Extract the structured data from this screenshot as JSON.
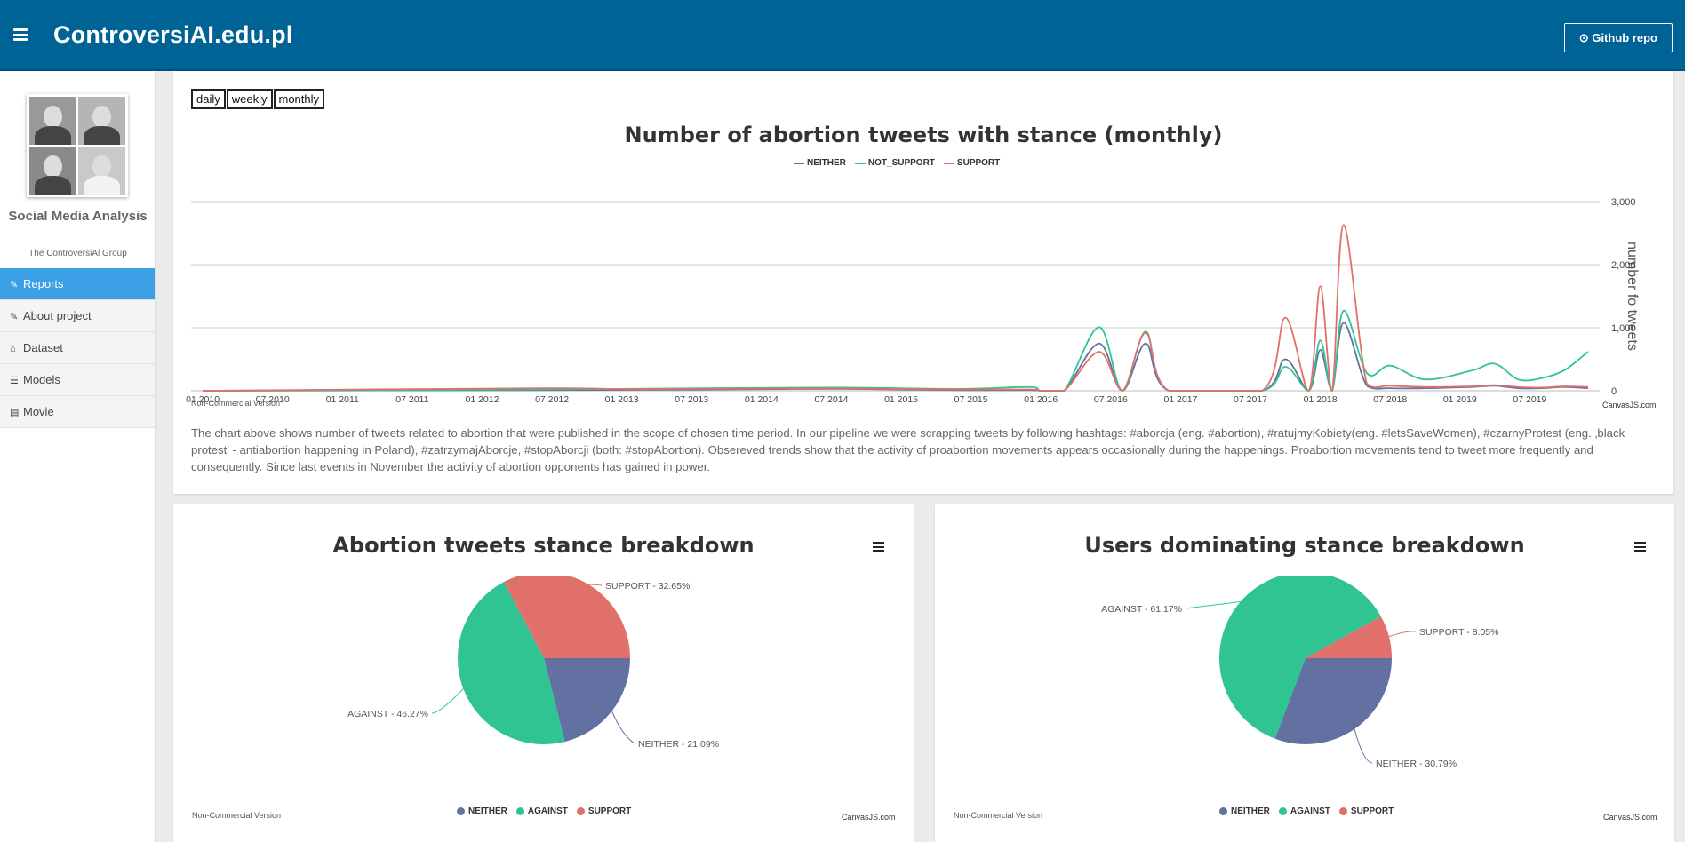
{
  "app": {
    "title": "ControversiAI.edu.pl",
    "github_label": "Github repo"
  },
  "sidebar": {
    "title": "Social Media Analysis",
    "subtitle": "The ControversiAl Group",
    "items": [
      {
        "label": "Reports",
        "icon": "edit-icon",
        "active": true
      },
      {
        "label": "About project",
        "icon": "edit-icon",
        "active": false
      },
      {
        "label": "Dataset",
        "icon": "home-icon",
        "active": false
      },
      {
        "label": "Models",
        "icon": "bars-icon",
        "active": false
      },
      {
        "label": "Movie",
        "icon": "file-icon",
        "active": false
      }
    ]
  },
  "range_buttons": [
    "daily",
    "weekly",
    "monthly"
  ],
  "colors": {
    "neither": "#6270a2",
    "against": "#2fc492",
    "support": "#e2706a",
    "header": "#006395",
    "active": "#3ca0e6"
  },
  "line_chart": {
    "watermark": "Non-Commercial Version",
    "credit": "CanvasJS.com",
    "description": "The chart above shows number of tweets related to abortion that were published in the scope of chosen time period. In our pipeline we were scrapping tweets by following hashtags: #aborcja (eng. #abortion), #ratujmyKobiety(eng. #letsSaveWomen), #czarnyProtest (eng. ‚black protest' - antiabortion happening in Poland), #zatrzymajAborcje, #stopAborcji (both: #stopAbortion). Obsereved trends show that the activity of proabortion movements appears occasionally during the happenings. Proabortion movements tend to tweet more frequently and consequently. Since last events in November the activity of abortion opponents has gained in power."
  },
  "pie_left": {
    "watermark": "Non-Commercial Version",
    "credit": "CanvasJS.com",
    "legend": [
      "NEITHER",
      "AGAINST",
      "SUPPORT"
    ]
  },
  "pie_right": {
    "watermark": "Non-Commercial Version",
    "credit": "CanvasJS.com",
    "legend": [
      "NEITHER",
      "AGAINST",
      "SUPPORT"
    ]
  },
  "chart_data": [
    {
      "type": "line",
      "title": "Number of abortion tweets with stance (monthly)",
      "ylabel": "number fo tweets",
      "xlabel": "",
      "ylim": [
        0,
        3000
      ],
      "yticks": [
        "0",
        "1,000",
        "2,000",
        "3,000"
      ],
      "xticks": [
        "01 2010",
        "07 2010",
        "01 2011",
        "07 2011",
        "01 2012",
        "07 2012",
        "01 2013",
        "07 2013",
        "01 2014",
        "07 2014",
        "01 2015",
        "07 2015",
        "01 2016",
        "07 2016",
        "01 2017",
        "07 2017",
        "01 2018",
        "07 2018",
        "01 2019",
        "07 2019"
      ],
      "legend_position": "top",
      "x": [
        "2016-03",
        "2016-06",
        "2016-08",
        "2016-10",
        "2016-12",
        "2017-08",
        "2017-10",
        "2017-12",
        "2018-01",
        "2018-02",
        "2018-03",
        "2018-05",
        "2018-07",
        "2018-10",
        "2019-02",
        "2019-04",
        "2019-06",
        "2019-08",
        "2019-10",
        "2019-12"
      ],
      "series": [
        {
          "name": "NEITHER",
          "values": [
            0,
            750,
            0,
            750,
            0,
            0,
            500,
            0,
            650,
            0,
            1080,
            80,
            40,
            40,
            60,
            80,
            40,
            40,
            60,
            40
          ]
        },
        {
          "name": "NOT_SUPPORT",
          "values": [
            0,
            1010,
            0,
            940,
            0,
            0,
            380,
            0,
            800,
            0,
            1270,
            280,
            400,
            180,
            320,
            430,
            180,
            200,
            330,
            620
          ]
        },
        {
          "name": "SUPPORT",
          "values": [
            0,
            620,
            0,
            920,
            0,
            0,
            1160,
            0,
            1660,
            0,
            2630,
            110,
            80,
            60,
            70,
            90,
            60,
            50,
            70,
            60
          ]
        }
      ]
    },
    {
      "type": "pie",
      "title": "Abortion tweets stance breakdown",
      "labels": [
        "NEITHER",
        "AGAINST",
        "SUPPORT"
      ],
      "values": [
        21.09,
        46.27,
        32.65
      ],
      "data_labels": [
        "NEITHER - 21.09%",
        "AGAINST - 46.27%",
        "SUPPORT - 32.65%"
      ],
      "legend_position": "bottom"
    },
    {
      "type": "pie",
      "title": "Users dominating stance breakdown",
      "labels": [
        "NEITHER",
        "AGAINST",
        "SUPPORT"
      ],
      "values": [
        30.79,
        61.17,
        8.05
      ],
      "data_labels": [
        "NEITHER - 30.79%",
        "AGAINST - 61.17%",
        "SUPPORT - 8.05%"
      ],
      "legend_position": "bottom"
    }
  ]
}
